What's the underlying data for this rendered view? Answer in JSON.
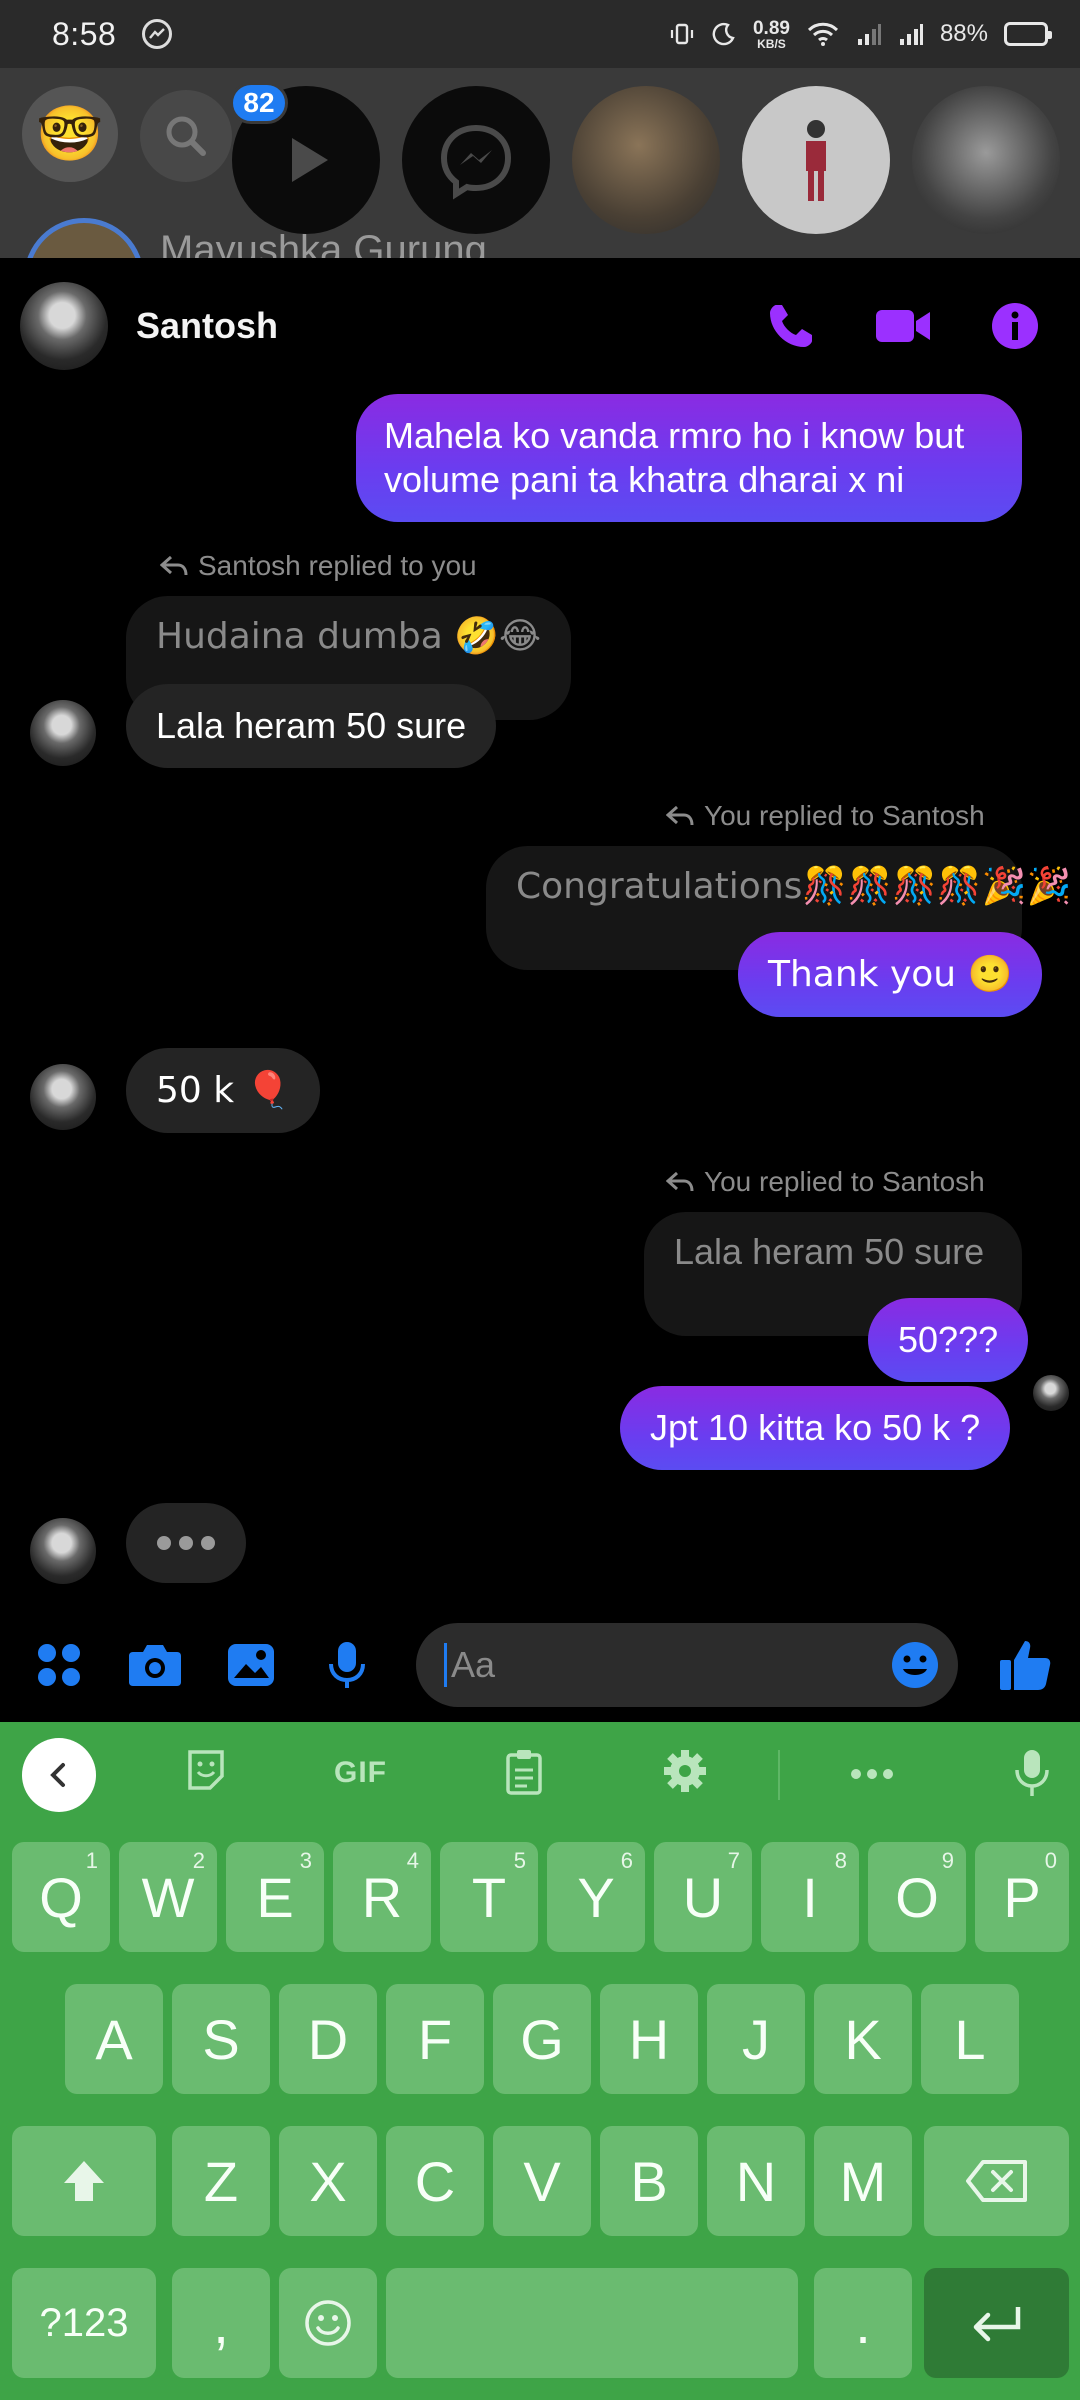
{
  "status_bar": {
    "time": "8:58",
    "net_speed": "0.89",
    "net_unit": "KB/S",
    "battery_pct": "88%",
    "battery_level": 0.88,
    "battery_color": "#f4c20d"
  },
  "background_app": {
    "unread_badge": "82",
    "peek_name": "Mayushka Gurung"
  },
  "chat": {
    "contact_name": "Santosh",
    "accent_color": "#8e2de2",
    "messages": [
      {
        "from": "me",
        "text_line1": "Mahela ko vanda rmro ho i know but",
        "text_line2": "volume pani ta khatra dharai  x ni"
      },
      {
        "reply_label": "Santosh replied to you",
        "quoted": "Hudaina dumba 🤣😂",
        "text": "Lala heram 50 sure"
      },
      {
        "reply_label": "You replied to Santosh",
        "quoted": "Congratulations🎊🎊🎊🎊🎉🎉",
        "text": "Thank you 🙂"
      },
      {
        "from": "them",
        "text": "50 k 🎈"
      },
      {
        "reply_label": "You replied to Santosh",
        "quoted": "Lala heram 50 sure",
        "text": "50???"
      },
      {
        "from": "me",
        "text": "Jpt 10 kitta ko 50 k ?"
      }
    ],
    "composer_placeholder": "Aa"
  },
  "keyboard": {
    "gif_label": "GIF",
    "row1": [
      {
        "key": "Q",
        "hint": "1"
      },
      {
        "key": "W",
        "hint": "2"
      },
      {
        "key": "E",
        "hint": "3"
      },
      {
        "key": "R",
        "hint": "4"
      },
      {
        "key": "T",
        "hint": "5"
      },
      {
        "key": "Y",
        "hint": "6"
      },
      {
        "key": "U",
        "hint": "7"
      },
      {
        "key": "I",
        "hint": "8"
      },
      {
        "key": "O",
        "hint": "9"
      },
      {
        "key": "P",
        "hint": "0"
      }
    ],
    "row2": [
      "A",
      "S",
      "D",
      "F",
      "G",
      "H",
      "J",
      "K",
      "L"
    ],
    "row3": [
      "Z",
      "X",
      "C",
      "V",
      "B",
      "N",
      "M"
    ],
    "symbols_label": "?123",
    "comma_label": ",",
    "period_label": ".",
    "theme_color": "#3ea447"
  }
}
